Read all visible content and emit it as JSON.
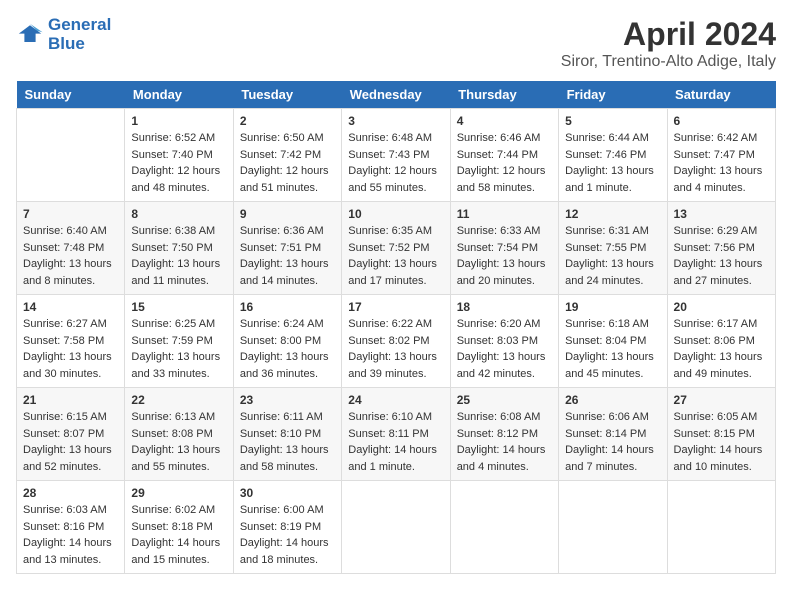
{
  "header": {
    "logo_line1": "General",
    "logo_line2": "Blue",
    "main_title": "April 2024",
    "subtitle": "Siror, Trentino-Alto Adige, Italy"
  },
  "days_of_week": [
    "Sunday",
    "Monday",
    "Tuesday",
    "Wednesday",
    "Thursday",
    "Friday",
    "Saturday"
  ],
  "weeks": [
    [
      {
        "day": "",
        "text": ""
      },
      {
        "day": "1",
        "text": "Sunrise: 6:52 AM\nSunset: 7:40 PM\nDaylight: 12 hours\nand 48 minutes."
      },
      {
        "day": "2",
        "text": "Sunrise: 6:50 AM\nSunset: 7:42 PM\nDaylight: 12 hours\nand 51 minutes."
      },
      {
        "day": "3",
        "text": "Sunrise: 6:48 AM\nSunset: 7:43 PM\nDaylight: 12 hours\nand 55 minutes."
      },
      {
        "day": "4",
        "text": "Sunrise: 6:46 AM\nSunset: 7:44 PM\nDaylight: 12 hours\nand 58 minutes."
      },
      {
        "day": "5",
        "text": "Sunrise: 6:44 AM\nSunset: 7:46 PM\nDaylight: 13 hours\nand 1 minute."
      },
      {
        "day": "6",
        "text": "Sunrise: 6:42 AM\nSunset: 7:47 PM\nDaylight: 13 hours\nand 4 minutes."
      }
    ],
    [
      {
        "day": "7",
        "text": "Sunrise: 6:40 AM\nSunset: 7:48 PM\nDaylight: 13 hours\nand 8 minutes."
      },
      {
        "day": "8",
        "text": "Sunrise: 6:38 AM\nSunset: 7:50 PM\nDaylight: 13 hours\nand 11 minutes."
      },
      {
        "day": "9",
        "text": "Sunrise: 6:36 AM\nSunset: 7:51 PM\nDaylight: 13 hours\nand 14 minutes."
      },
      {
        "day": "10",
        "text": "Sunrise: 6:35 AM\nSunset: 7:52 PM\nDaylight: 13 hours\nand 17 minutes."
      },
      {
        "day": "11",
        "text": "Sunrise: 6:33 AM\nSunset: 7:54 PM\nDaylight: 13 hours\nand 20 minutes."
      },
      {
        "day": "12",
        "text": "Sunrise: 6:31 AM\nSunset: 7:55 PM\nDaylight: 13 hours\nand 24 minutes."
      },
      {
        "day": "13",
        "text": "Sunrise: 6:29 AM\nSunset: 7:56 PM\nDaylight: 13 hours\nand 27 minutes."
      }
    ],
    [
      {
        "day": "14",
        "text": "Sunrise: 6:27 AM\nSunset: 7:58 PM\nDaylight: 13 hours\nand 30 minutes."
      },
      {
        "day": "15",
        "text": "Sunrise: 6:25 AM\nSunset: 7:59 PM\nDaylight: 13 hours\nand 33 minutes."
      },
      {
        "day": "16",
        "text": "Sunrise: 6:24 AM\nSunset: 8:00 PM\nDaylight: 13 hours\nand 36 minutes."
      },
      {
        "day": "17",
        "text": "Sunrise: 6:22 AM\nSunset: 8:02 PM\nDaylight: 13 hours\nand 39 minutes."
      },
      {
        "day": "18",
        "text": "Sunrise: 6:20 AM\nSunset: 8:03 PM\nDaylight: 13 hours\nand 42 minutes."
      },
      {
        "day": "19",
        "text": "Sunrise: 6:18 AM\nSunset: 8:04 PM\nDaylight: 13 hours\nand 45 minutes."
      },
      {
        "day": "20",
        "text": "Sunrise: 6:17 AM\nSunset: 8:06 PM\nDaylight: 13 hours\nand 49 minutes."
      }
    ],
    [
      {
        "day": "21",
        "text": "Sunrise: 6:15 AM\nSunset: 8:07 PM\nDaylight: 13 hours\nand 52 minutes."
      },
      {
        "day": "22",
        "text": "Sunrise: 6:13 AM\nSunset: 8:08 PM\nDaylight: 13 hours\nand 55 minutes."
      },
      {
        "day": "23",
        "text": "Sunrise: 6:11 AM\nSunset: 8:10 PM\nDaylight: 13 hours\nand 58 minutes."
      },
      {
        "day": "24",
        "text": "Sunrise: 6:10 AM\nSunset: 8:11 PM\nDaylight: 14 hours\nand 1 minute."
      },
      {
        "day": "25",
        "text": "Sunrise: 6:08 AM\nSunset: 8:12 PM\nDaylight: 14 hours\nand 4 minutes."
      },
      {
        "day": "26",
        "text": "Sunrise: 6:06 AM\nSunset: 8:14 PM\nDaylight: 14 hours\nand 7 minutes."
      },
      {
        "day": "27",
        "text": "Sunrise: 6:05 AM\nSunset: 8:15 PM\nDaylight: 14 hours\nand 10 minutes."
      }
    ],
    [
      {
        "day": "28",
        "text": "Sunrise: 6:03 AM\nSunset: 8:16 PM\nDaylight: 14 hours\nand 13 minutes."
      },
      {
        "day": "29",
        "text": "Sunrise: 6:02 AM\nSunset: 8:18 PM\nDaylight: 14 hours\nand 15 minutes."
      },
      {
        "day": "30",
        "text": "Sunrise: 6:00 AM\nSunset: 8:19 PM\nDaylight: 14 hours\nand 18 minutes."
      },
      {
        "day": "",
        "text": ""
      },
      {
        "day": "",
        "text": ""
      },
      {
        "day": "",
        "text": ""
      },
      {
        "day": "",
        "text": ""
      }
    ]
  ]
}
